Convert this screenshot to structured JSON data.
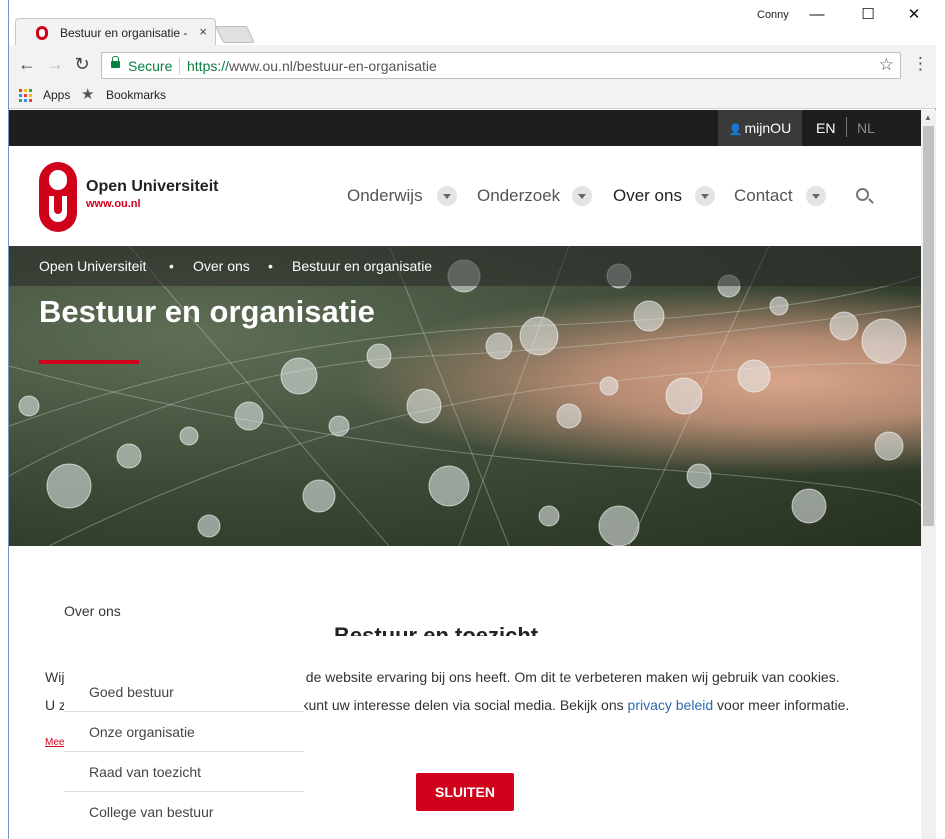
{
  "browser": {
    "tab_title": "Bestuur en organisatie - ",
    "tab_close": "×",
    "user": "Conny",
    "minimize": "—",
    "maximize": "☐",
    "close": "✕",
    "back": "←",
    "forward": "→",
    "reload": "↻",
    "secure_label": "Secure",
    "url_scheme": "https://",
    "url_rest": "www.ou.nl/bestuur-en-organisatie",
    "star": "☆",
    "menu": "⋮",
    "bookmarks": [
      {
        "label": "Apps",
        "icon": "apps-grid-icon"
      },
      {
        "label": "Bookmarks",
        "icon": "star-icon"
      }
    ]
  },
  "page": {
    "topbar": {
      "mijnou": "mijnOU",
      "person_icon": "👤",
      "lang_en": "EN",
      "lang_nl": "NL"
    },
    "logo": {
      "name": "Open Universiteit",
      "url": "www.ou.nl"
    },
    "nav": [
      {
        "label": "Onderwijs",
        "active": false
      },
      {
        "label": "Onderzoek",
        "active": false
      },
      {
        "label": "Over ons",
        "active": true
      },
      {
        "label": "Contact",
        "active": false
      }
    ],
    "breadcrumb": [
      "Open Universiteit",
      "Over ons",
      "Bestuur en organisatie"
    ],
    "breadcrumb_sep": "•",
    "hero_title": "Bestuur en organisatie",
    "sidenav_title": "Over ons",
    "content_heading": "Bestuur en toezicht",
    "sidenav": [
      "Goed bestuur",
      "Onze organisatie",
      "Raad van toezicht",
      "College van bestuur"
    ],
    "cookie": {
      "line1_start": "Wij zor",
      "line1_end": "de website ervaring bij ons heeft. Om dit te verbeteren maken wij gebruik van cookies.",
      "line2_start": "U ziet a",
      "line2_end": "kunt uw interesse delen via social media. Bekijk ons ",
      "link": "privacy beleid",
      "line2_tail": " voor meer informatie.",
      "meer": "Meer leze",
      "button": "SLUITEN"
    },
    "colors": {
      "brand_red": "#d0021b",
      "topbar": "#1e1e1e",
      "link": "#2b6cb0"
    }
  }
}
